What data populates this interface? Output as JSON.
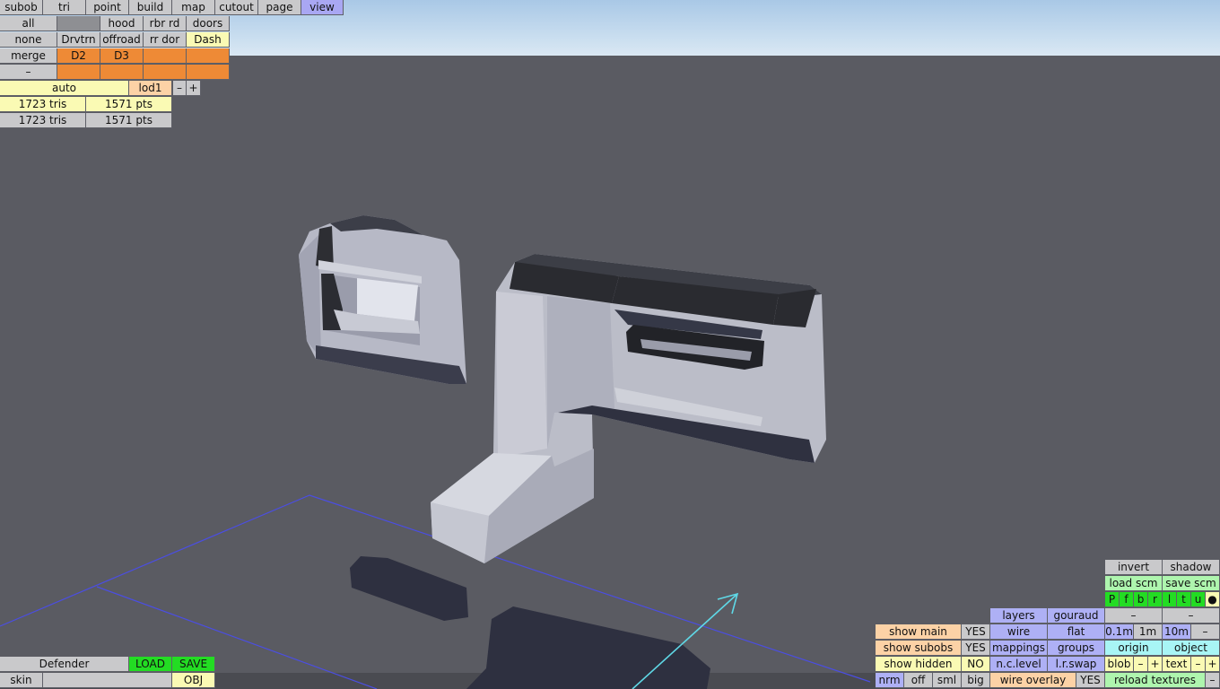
{
  "top_menu": [
    "subob",
    "tri",
    "point",
    "build",
    "map",
    "cutout",
    "page",
    "view"
  ],
  "active_menu": "view",
  "sub_rows": {
    "row1": [
      "all",
      "",
      "hood",
      "rbr rd",
      "doors"
    ],
    "row2": [
      "none",
      "Drvtrn",
      "offroad",
      "rr dor",
      "Dash"
    ],
    "row3": [
      "merge",
      "D2",
      "D3",
      "",
      ""
    ],
    "row4": [
      "–",
      "",
      "",
      "",
      ""
    ]
  },
  "lod": {
    "auto": "auto",
    "lod": "lod1",
    "minus": "–",
    "plus": "+"
  },
  "stats": [
    {
      "tris": "1723 tris",
      "pts": "1571 pts"
    },
    {
      "tris": "1723 tris",
      "pts": "1571 pts"
    }
  ],
  "file": {
    "name": "Defender",
    "load": "LOAD",
    "save": "SAVE",
    "skin_label": "skin",
    "skin_value": "",
    "format": "OBJ"
  },
  "right_panel": {
    "invert": "invert",
    "shadow": "shadow",
    "load_scm": "load scm",
    "save_scm": "save scm",
    "view_letters": [
      "P",
      "f",
      "b",
      "r",
      "l",
      "t",
      "u",
      "●"
    ],
    "layers": "layers",
    "gouraud": "gouraud",
    "dash1": "–",
    "dash2": "–",
    "show_main": "show main",
    "show_main_val": "YES",
    "wire": "wire",
    "flat": "flat",
    "grid": [
      "0.1m",
      "1m",
      "10m",
      "–"
    ],
    "show_subobs": "show subobs",
    "show_subobs_val": "YES",
    "mappings": "mappings",
    "groups": "groups",
    "origin": "origin",
    "object": "object",
    "show_hidden": "show hidden",
    "show_hidden_val": "NO",
    "nc_level": "n.c.level",
    "lr_swap": "l.r.swap",
    "blob": "blob",
    "text": "text",
    "minus": "–",
    "plus": "+",
    "size_opts": [
      "nrm",
      "off",
      "sml",
      "big"
    ],
    "wire_overlay": "wire overlay",
    "wire_overlay_val": "YES",
    "reload_textures": "reload textures",
    "reload_dash": "–"
  }
}
